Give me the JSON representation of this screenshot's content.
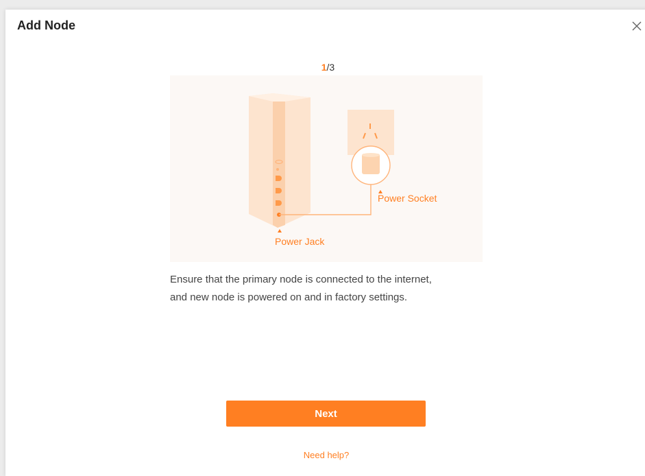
{
  "dialog": {
    "title": "Add Node",
    "close_icon": "close-icon"
  },
  "stepper": {
    "current": "1",
    "total_text": "/3"
  },
  "illustration": {
    "power_socket_label": "Power Socket",
    "power_jack_label": "Power Jack"
  },
  "description": {
    "line1": "Ensure that the primary node is connected to the internet,",
    "line2": "and new node is powered on and in factory settings."
  },
  "actions": {
    "next_label": "Next",
    "help_label": "Need help?"
  },
  "colors": {
    "accent": "#ff7f22",
    "illustration_bg": "#fcf8f5",
    "device_light": "#fde4cf"
  }
}
